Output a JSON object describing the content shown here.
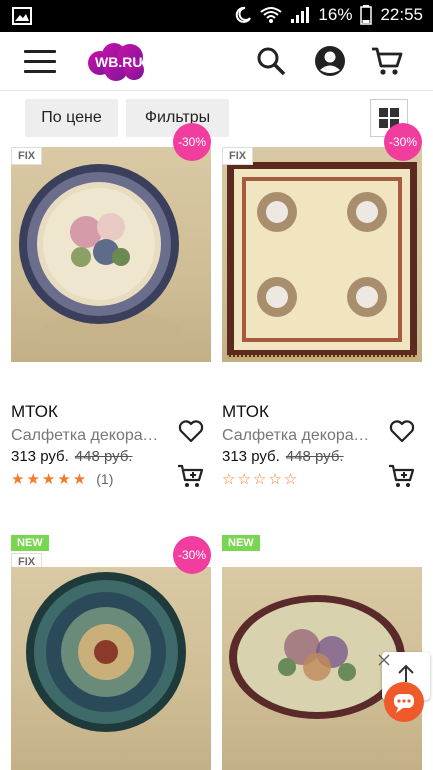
{
  "status_bar": {
    "battery": "16%",
    "time": "22:55"
  },
  "app_bar": {
    "logo_text": "WB.RU"
  },
  "filter_bar": {
    "sort_label": "По цене",
    "filters_label": "Фильтры"
  },
  "products": [
    {
      "brand": "МТОК",
      "name": "Салфетка декоративная",
      "price": "313 руб.",
      "old_price": "448 руб.",
      "rating_count": "(1)",
      "badge_fix": "FIX",
      "discount": "-30%"
    },
    {
      "brand": "МТОК",
      "name": "Салфетка декоративная",
      "price": "313 руб.",
      "old_price": "448 руб.",
      "badge_fix": "FIX",
      "discount": "-30%"
    },
    {
      "badge_new": "NEW",
      "badge_fix": "FIX",
      "discount": "-30%"
    },
    {
      "badge_new": "NEW"
    }
  ],
  "ratings": {
    "product1_stars": 5,
    "product2_stars": 0
  },
  "colors": {
    "brand_gradient_start": "#cb11ab",
    "brand_gradient_end": "#481173",
    "discount_badge": "#f03d9e",
    "new_badge": "#7ad650",
    "star": "#f37a2a",
    "chat_fab": "#f05a2a"
  },
  "icons": [
    "menu-icon",
    "search-icon",
    "account-icon",
    "cart-icon",
    "grid-view-icon",
    "heart-icon",
    "add-to-cart-icon",
    "scroll-up-icon",
    "chat-icon"
  ]
}
